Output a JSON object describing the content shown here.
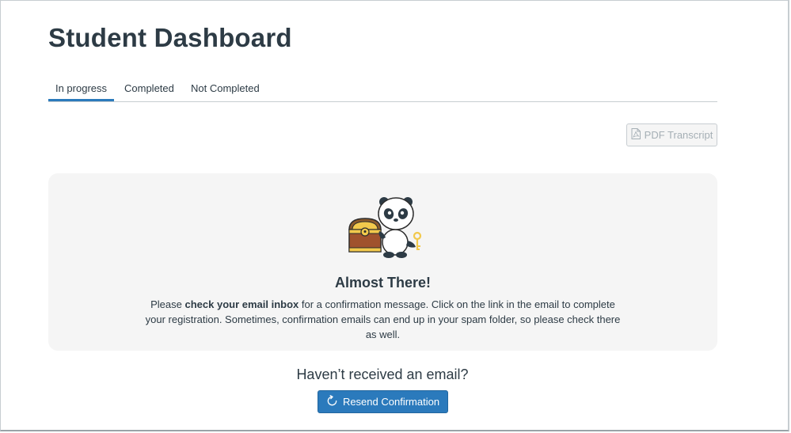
{
  "page": {
    "title": "Student Dashboard"
  },
  "tabs": [
    {
      "label": "In progress",
      "active": true
    },
    {
      "label": "Completed",
      "active": false
    },
    {
      "label": "Not Completed",
      "active": false
    }
  ],
  "toolbar": {
    "pdf_label": "PDF Transcript",
    "pdf_icon": "pdf-file-icon"
  },
  "notice": {
    "illustration": "panda-with-treasure-chest",
    "heading": "Almost There!",
    "text_before": "Please ",
    "text_bold": "check your email inbox",
    "text_after": " for a confirmation message. Click on the link in the email to complete your registration. Sometimes, confirmation emails can end up in your spam folder, so please check there as well."
  },
  "resend": {
    "heading": "Haven’t received an email?",
    "button_label": "Resend Confirmation",
    "button_icon": "refresh-icon"
  },
  "colors": {
    "accent": "#2b7abc",
    "text": "#2d3b45",
    "panel_bg": "#f5f5f5",
    "border": "#c7cdd1"
  }
}
